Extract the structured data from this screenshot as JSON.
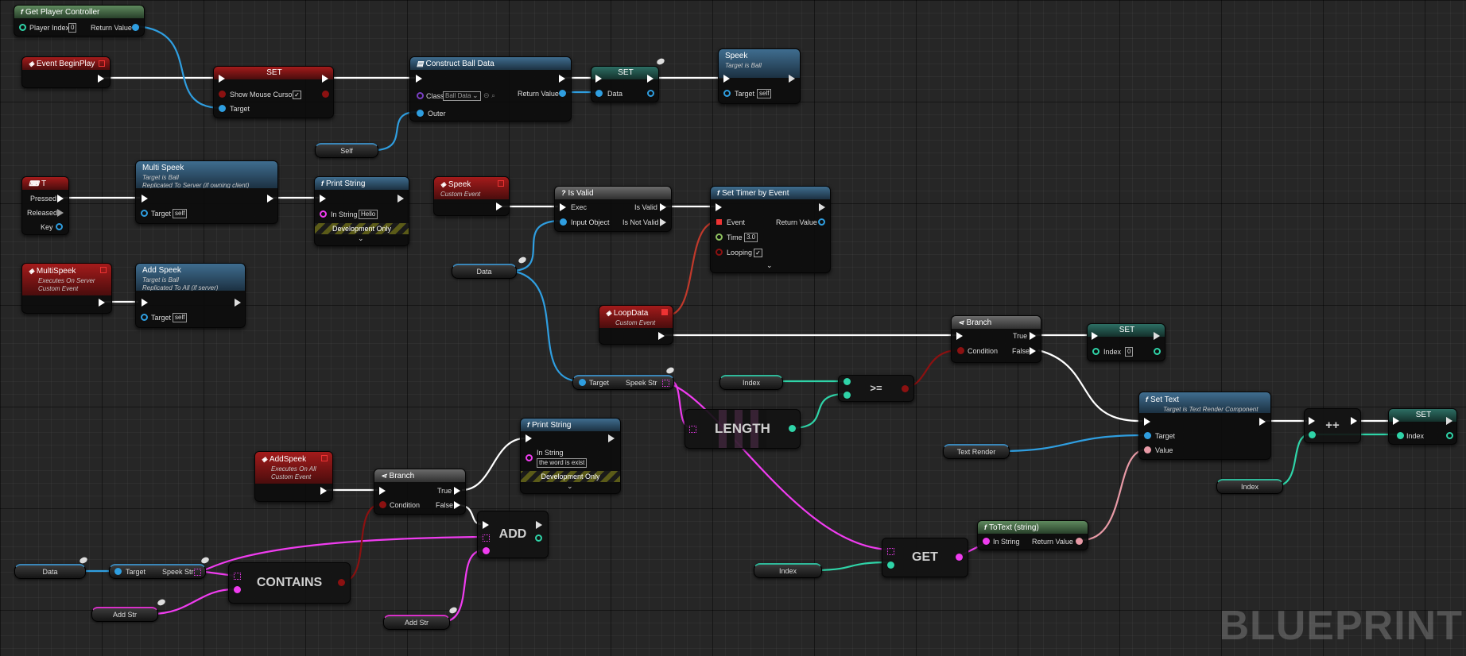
{
  "watermark": "BLUEPRINT",
  "colors": {
    "exec": "#ffffff",
    "object": "#2f9ee0",
    "string": "#f03cf0",
    "int": "#2fd4a8",
    "bool": "#8b1111",
    "text": "#e89aa6"
  },
  "nodes": {
    "get_player_controller": {
      "title": "Get Player Controller",
      "player_index": "Player Index",
      "player_index_value": "0",
      "return_value": "Return Value"
    },
    "event_begin_play": {
      "title": "Event BeginPlay"
    },
    "set_mouse": {
      "title": "SET",
      "show_mouse_cursor": "Show Mouse Cursor",
      "target": "Target",
      "checked": "✓"
    },
    "self_var": {
      "label": "Self"
    },
    "construct_ball_data": {
      "title": "Construct Ball Data",
      "class": "Class",
      "class_value": "Ball Data",
      "return_value": "Return Value",
      "outer": "Outer"
    },
    "set_data": {
      "title": "SET",
      "data": "Data"
    },
    "speek": {
      "title": "Speek",
      "subtitle": "Target is Ball",
      "target": "Target",
      "target_value": "self"
    },
    "t_key": {
      "title": "T",
      "pressed": "Pressed",
      "released": "Released",
      "key": "Key"
    },
    "multi_speek_call": {
      "title": "Multi Speek",
      "subtitle1": "Target is Ball",
      "subtitle2": "Replicated To Server (if owning client)",
      "target": "Target",
      "target_value": "self"
    },
    "print_string_1": {
      "title": "Print String",
      "in_string": "In String",
      "in_string_value": "Hello",
      "dev_only": "Development Only"
    },
    "speek_event": {
      "title": "Speek",
      "subtitle": "Custom Event"
    },
    "is_valid": {
      "title": "Is Valid",
      "exec": "Exec",
      "input_object": "Input Object",
      "is_valid": "Is Valid",
      "is_not_valid": "Is Not Valid"
    },
    "set_timer": {
      "title": "Set Timer by Event",
      "event": "Event",
      "return_value": "Return Value",
      "time": "Time",
      "time_value": "3.0",
      "looping": "Looping",
      "checked": "✓"
    },
    "multispeek_event": {
      "title": "MultiSpeek",
      "subtitle1": "Executes On Server",
      "subtitle2": "Custom Event"
    },
    "add_speek_call": {
      "title": "Add Speek",
      "subtitle1": "Target is Ball",
      "subtitle2": "Replicated To All (if server)",
      "target": "Target",
      "target_value": "self"
    },
    "data_var_1": {
      "label": "Data"
    },
    "loopdata_event": {
      "title": "LoopData",
      "subtitle": "Custom Event"
    },
    "branch_1": {
      "title": "Branch",
      "condition": "Condition",
      "true": "True",
      "false": "False"
    },
    "set_index_0": {
      "title": "SET",
      "index": "Index",
      "index_value": "0"
    },
    "speek_str_get_1": {
      "target": "Target",
      "speek_str": "Speek Str"
    },
    "index_var_1": {
      "label": "Index"
    },
    "gte": {
      "label": ">="
    },
    "length": {
      "label": "LENGTH"
    },
    "set_text": {
      "title": "Set Text",
      "subtitle": "Target is Text Render Component",
      "target": "Target",
      "value": "Value"
    },
    "text_render_var": {
      "label": "Text Render"
    },
    "increment": {
      "label": "++"
    },
    "set_index": {
      "title": "SET",
      "index": "Index"
    },
    "index_var_2": {
      "label": "Index"
    },
    "addspeek_event": {
      "title": "AddSpeek",
      "subtitle1": "Executes On All",
      "subtitle2": "Custom Event"
    },
    "branch_2": {
      "title": "Branch",
      "condition": "Condition",
      "true": "True",
      "false": "False"
    },
    "print_string_2": {
      "title": "Print String",
      "in_string": "In String",
      "in_string_value": "the word is exist",
      "dev_only": "Development Only"
    },
    "add": {
      "label": "ADD"
    },
    "data_var_2": {
      "label": "Data"
    },
    "speek_str_get_2": {
      "target": "Target",
      "speek_str": "Speek Str"
    },
    "contains": {
      "label": "CONTAINS"
    },
    "add_str_var_1": {
      "label": "Add Str"
    },
    "add_str_var_2": {
      "label": "Add Str"
    },
    "get": {
      "label": "GET"
    },
    "index_var_3": {
      "label": "Index"
    },
    "to_text": {
      "title": "ToText (string)",
      "in_string": "In String",
      "return_value": "Return Value"
    }
  }
}
